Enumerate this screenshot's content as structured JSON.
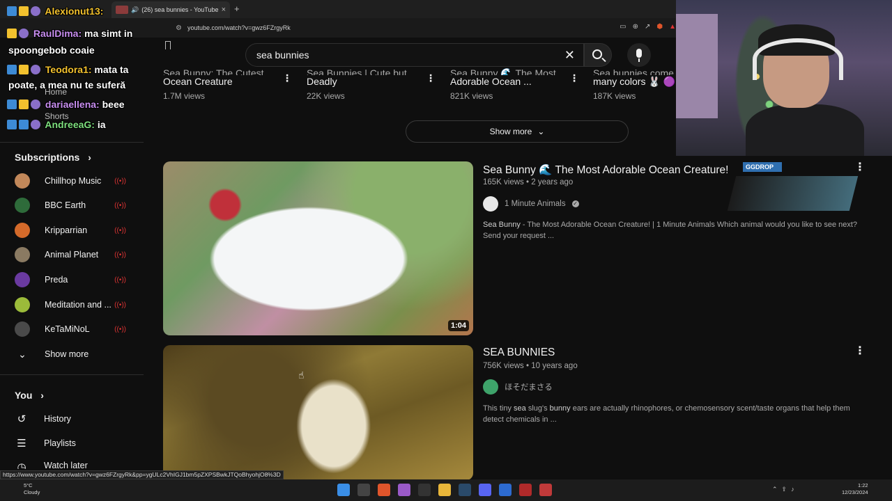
{
  "browser": {
    "tab_title": "(26) sea bunnies - YouTube",
    "tab_close": "×",
    "new_tab": "+",
    "url": "youtube.com/watch?v=gwz6FZrgyRk",
    "status_url": "https://www.youtube.com/watch?v=gwz6FZrgyRk&pp=ygULc2VhIGJ1bm5pZXPSBwkJTQoBhyohjO8%3D"
  },
  "search": {
    "query": "sea bunnies",
    "clear_label": "✕"
  },
  "shelf": [
    {
      "title_top": "Sea Bunny: The Cutest",
      "title": "Ocean Creature",
      "views": "1.7M views"
    },
    {
      "title_top": "Sea Bunnies | Cute but",
      "title": "Deadly",
      "views": "22K views"
    },
    {
      "title_top": "Sea Bunny 🌊 The Most",
      "title": "Adorable Ocean ...",
      "views": "821K views"
    },
    {
      "title_top": "Sea bunnies come in",
      "title": "many colors 🐰 🟣",
      "views": "187K views"
    }
  ],
  "show_more_label": "Show more",
  "sidebar": {
    "home": "Home",
    "shorts": "Shorts",
    "subscriptions_label": "Subscriptions",
    "subscriptions": [
      {
        "name": "Chillhop Music",
        "color": "#c2885a"
      },
      {
        "name": "BBC Earth",
        "color": "#2e6b3a"
      },
      {
        "name": "Kripparrian",
        "color": "#d46a2a"
      },
      {
        "name": "Animal Planet",
        "color": "#8a7a62"
      },
      {
        "name": "Preda",
        "color": "#6a3aa0"
      },
      {
        "name": "Meditation and ...",
        "color": "#9bbb3a"
      },
      {
        "name": "KeTaMiNoL",
        "color": "#4a4a4a"
      }
    ],
    "show_more": "Show more",
    "you_label": "You",
    "you_items": [
      {
        "label": "History",
        "icon": "↺"
      },
      {
        "label": "Playlists",
        "icon": "☰"
      },
      {
        "label": "Watch later",
        "icon": "◷"
      }
    ]
  },
  "chat": [
    {
      "user": "Alexionut13:",
      "msg": "",
      "color": "#f2c12e"
    },
    {
      "user": "RaulDima:",
      "msg": "ma simt in",
      "msg2": "spoongebob coaie",
      "color": "#c88ef0"
    },
    {
      "user": "Teodora1:",
      "msg": "mata ta",
      "msg2": "poate, a mea nu te suferă",
      "color": "#f2c12e"
    },
    {
      "user": "dariaellena:",
      "msg": "beee",
      "color": "#c88ef0"
    },
    {
      "user": "AndreeaG:",
      "msg": "ia",
      "color": "#7ee07e"
    }
  ],
  "videos": [
    {
      "title": "Sea Bunny 🌊 The Most Adorable Ocean Creature!",
      "views": "165K views",
      "age": "2 years ago",
      "channel": "1 Minute Animals",
      "verified": true,
      "channel_color": "#e8e8e8",
      "desc_bold": "Sea Bunny",
      "desc": " - The Most Adorable Ocean Creature! | 1 Minute Animals Which animal would you like to see next? Send your request ...",
      "duration": "1:04"
    },
    {
      "title": "SEA BUNNIES",
      "views": "756K views",
      "age": "10 years ago",
      "channel": "ほそだまさる",
      "verified": false,
      "channel_color": "#3ea36a",
      "desc_pre": "This tiny ",
      "desc_b1": "sea",
      "desc_mid": " slug's ",
      "desc_b2": "bunny",
      "desc_post": " ears are actually rhinophores, or chemosensory scent/taste organs that help them detect chemicals in ...",
      "duration": ""
    }
  ],
  "overlay": {
    "ggdrop_label": "GGDROP"
  },
  "taskbar": {
    "temp": "5°C",
    "weather": "Cloudy",
    "time": "1:22",
    "date": "12/23/2024"
  }
}
